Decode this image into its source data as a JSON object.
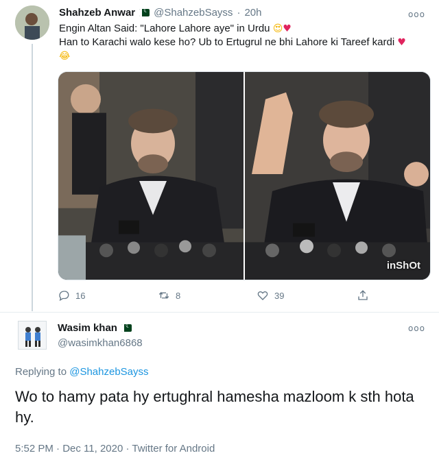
{
  "tweet1": {
    "author_name": "Shahzeb Anwar",
    "handle": "@ShahzebSayss",
    "separator": "·",
    "time": "20h",
    "text_line1": "Engin Altan Said: \"Lahore Lahore aye\" in Urdu",
    "text_line2": "Han to Karachi walo kese ho? Ub to Ertugrul ne bhi Lahore ki Tareef kardi",
    "emoji_heart_eyes": "😍",
    "emoji_heart": "♥",
    "emoji_laugh": "😂",
    "media_watermark": "inShOt",
    "actions": {
      "replies": "16",
      "retweets": "8",
      "likes": "39"
    },
    "more_label": "ooo"
  },
  "tweet2": {
    "author_name": "Wasim khan",
    "handle": "@wasimkhan6868",
    "more_label": "ooo",
    "replying_prefix": "Replying to",
    "replying_to": "@ShahzebSayss",
    "text": "Wo to hamy pata hy ertughral hamesha mazloom k sth hota hy.",
    "time": "5:52 PM",
    "date": "Dec 11, 2020",
    "source": "Twitter for Android",
    "meta_sep": "·"
  },
  "colors": {
    "text": "#14171a",
    "secondary": "#657786",
    "link": "#1b95e0",
    "heart": "#e0245e",
    "border": "#e6ecf0"
  },
  "icons": [
    "verified-flag-icon",
    "more-options-icon",
    "reply-icon",
    "retweet-icon",
    "like-icon",
    "share-icon"
  ]
}
